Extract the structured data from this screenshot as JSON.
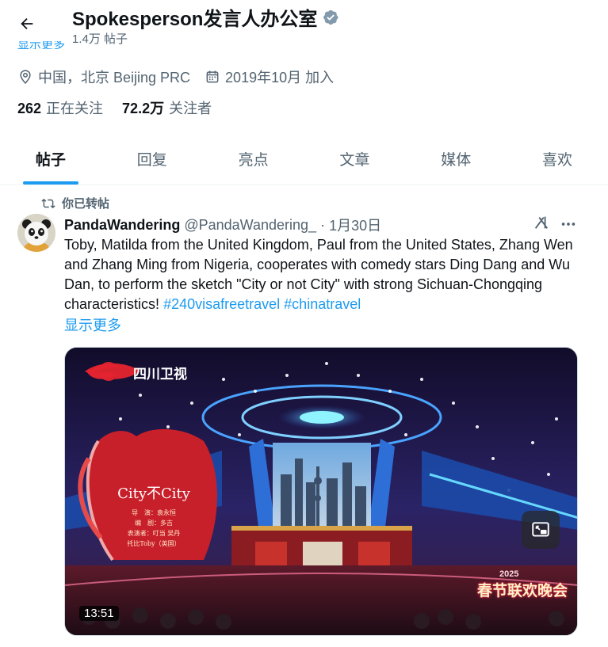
{
  "header": {
    "back_icon": "arrow-left-icon",
    "profile_name": "Spokesperson发言人办公室",
    "verified_icon": "verified-badge-icon",
    "verified_color": "#829aab",
    "post_count": "1.4万 帖子"
  },
  "clipped_link": "显示更多",
  "profile_meta": {
    "location_icon": "location-pin-icon",
    "location": "中国，北京 Beijing PRC",
    "joined_icon": "calendar-icon",
    "joined": "2019年10月 加入",
    "following_count": "262",
    "following_label": "正在关注",
    "followers_count": "72.2万",
    "followers_label": "关注者"
  },
  "tabs": [
    {
      "label": "帖子",
      "active": true
    },
    {
      "label": "回复",
      "active": false
    },
    {
      "label": "亮点",
      "active": false
    },
    {
      "label": "文章",
      "active": false
    },
    {
      "label": "媒体",
      "active": false
    },
    {
      "label": "喜欢",
      "active": false
    }
  ],
  "post": {
    "repost_icon": "repost-icon",
    "repost_label": "你已转帖",
    "author_name": "PandaWandering",
    "author_handle": "@PandaWandering_",
    "separator": "·",
    "date": "1月30日",
    "grok_icon": "grok-icon",
    "more_icon": "more-options-icon",
    "text": "Toby, Matilda from the United Kingdom, Paul from the United States, Zhang Wen and Zhang Ming from Nigeria, cooperates with comedy stars Ding Dang and Wu Dan, to perform the sketch \"City or not City\" with strong Sichuan-Chongqing characteristics!",
    "hashtags": [
      "#240visafreetravel",
      "#chinatravel"
    ],
    "show_more": "显示更多",
    "video": {
      "channel_logo": "四川卫视",
      "banner_title": "City不City",
      "banner_credits": [
        "导　演：袁永恒",
        "编　剧：多吉",
        "表演者：叮当 吴丹",
        "托比Toby（英国）"
      ],
      "gala_year": "2025",
      "gala_name": "春节联欢晚会",
      "duration": "13:51",
      "pip_icon": "picture-in-picture-icon"
    }
  },
  "colors": {
    "accent": "#1d9bf0",
    "text_primary": "#0f1419",
    "text_secondary": "#536471",
    "divider": "#eff3f4"
  }
}
